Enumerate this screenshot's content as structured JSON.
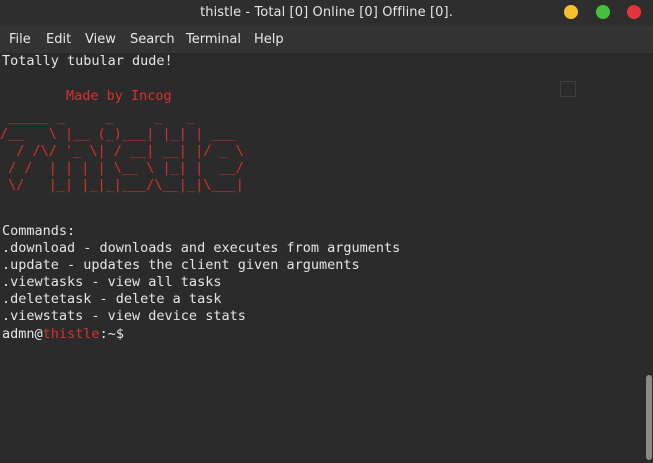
{
  "window": {
    "title": "thistle - Total [0] Online [0] Offline [0].",
    "controls": {
      "minimize_color": "#f5c02b",
      "maximize_color": "#44c03a",
      "close_color": "#e7343a"
    }
  },
  "menu": {
    "items": [
      "File",
      "Edit",
      "View",
      "Search",
      "Terminal",
      "Help"
    ]
  },
  "terminal": {
    "greeting": "Totally tubular dude!",
    "credit": "Made by Incog",
    "logo_ascii": " _____ _     _     _   _\n/__   \\ |__ (_)___| |_| | ___\n  / /\\/ '_ \\| / __| __| |/ _ \\\n / /  | | | | \\__ \\ |_| |  __/\n \\/   |_| |_|_|___/\\__|_|\\___|",
    "commands_header": "Commands:",
    "commands": [
      ".download - downloads and executes from arguments",
      ".update - updates the client given arguments",
      ".viewtasks - view all tasks",
      ".deletetask - delete a task",
      ".viewstats - view device stats"
    ],
    "prompt_user": "admn",
    "prompt_at": "@",
    "prompt_host": "thistle",
    "prompt_path": ":~$",
    "accent_color": "#d8312c"
  }
}
